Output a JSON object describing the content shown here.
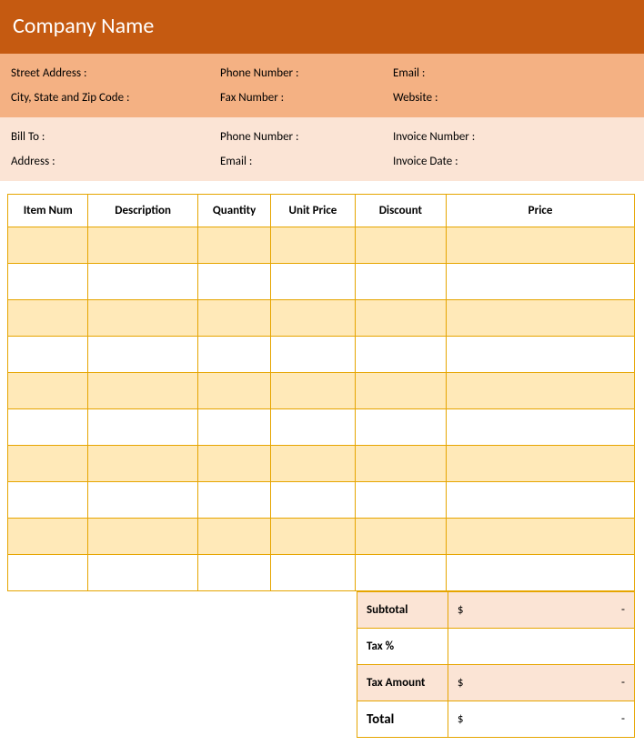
{
  "header": {
    "company_name": "Company Name"
  },
  "info_top": {
    "street": "Street Address :",
    "phone": "Phone Number :",
    "email": "Email :",
    "city": "City, State and Zip Code :",
    "fax": "Fax Number :",
    "website": "Website :"
  },
  "info_bill": {
    "bill_to": "Bill To :",
    "phone": "Phone Number :",
    "inv_no": "Invoice Number :",
    "address": "Address :",
    "email": "Email :",
    "inv_date": "Invoice Date :"
  },
  "columns": {
    "item_num": "Item Num",
    "description": "Description",
    "quantity": "Quantity",
    "unit_price": "Unit Price",
    "discount": "Discount",
    "price": "Price"
  },
  "totals": {
    "subtotal_label": "Subtotal",
    "subtotal_currency": "$",
    "subtotal_value": "-",
    "tax_pct_label": "Tax %",
    "tax_pct_value": "",
    "tax_amt_label": "Tax Amount",
    "tax_amt_currency": "$",
    "tax_amt_value": "-",
    "total_label": "Total",
    "total_currency": "$",
    "total_value": "-"
  }
}
